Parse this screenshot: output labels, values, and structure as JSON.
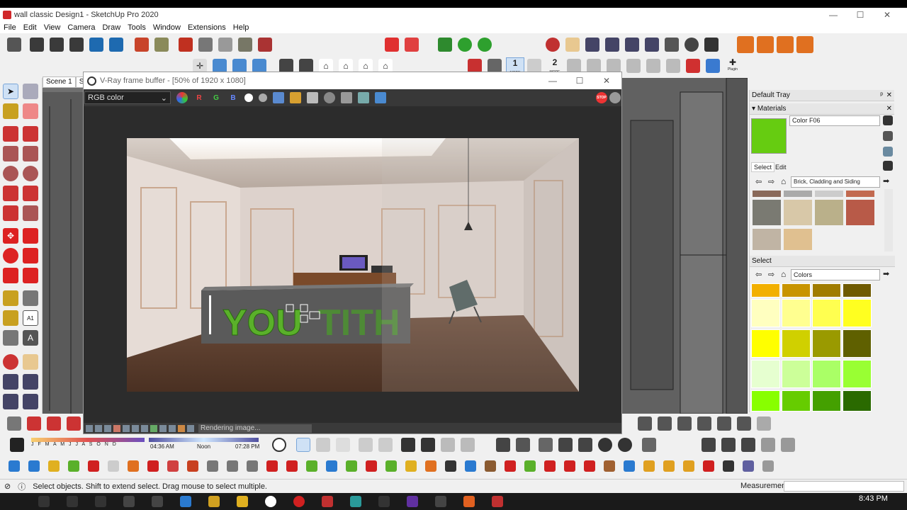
{
  "window": {
    "title": "wall classic Design1 - SketchUp Pro 2020",
    "minimize": "—",
    "maximize": "☐",
    "close": "✕"
  },
  "menu": [
    "File",
    "Edit",
    "View",
    "Camera",
    "Draw",
    "Tools",
    "Window",
    "Extensions",
    "Help"
  ],
  "toolbar2": {
    "mode1": "1",
    "mode2": "2",
    "mode_label": "MODE",
    "plugin_label": "Plugin"
  },
  "scene_tabs": [
    "Scene 1",
    "Sce"
  ],
  "vfb": {
    "title": "V-Ray frame buffer - [50% of 1920 x 1080]",
    "channel": "RGB color",
    "r": "R",
    "g": "G",
    "b": "B",
    "status": "Rendering image...",
    "scene_sign": "YOU",
    "scene_sign2": "TITH"
  },
  "tray": {
    "title": "Default Tray",
    "pin": "ᵖ",
    "close": "✕",
    "materials_header": "Materials",
    "material_name": "Color F06",
    "material_color": "#66cc11",
    "select_tab": "Select",
    "edit_tab": "Edit",
    "collection1": "Brick, Cladding and Siding",
    "select_label": "Select",
    "collection2": "Colors"
  },
  "shadow": {
    "months": "J F M A M J J A S O N D",
    "time_start": "04:36 AM",
    "time_mid": "Noon",
    "time_end": "07:28 PM"
  },
  "status": {
    "message": "Select objects. Shift to extend select. Drag mouse to select multiple.",
    "measurements_label": "Measurements"
  },
  "taskbar": {
    "time": "8:43 PM"
  },
  "colors": {
    "sw_rows": [
      [
        "#f2b000",
        "#c89400",
        "#a07c00",
        "#6f5a00"
      ],
      [
        "#ffffc0",
        "#ffff90",
        "#ffff50",
        "#ffff20"
      ],
      [
        "#ffff00",
        "#d0d000",
        "#9a9a00",
        "#5f6000"
      ],
      [
        "#e6ffd0",
        "#ccff99",
        "#aaff66",
        "#99ff33"
      ],
      [
        "#88ff00",
        "#66cc00",
        "#44a000",
        "#2a6a00"
      ]
    ]
  }
}
